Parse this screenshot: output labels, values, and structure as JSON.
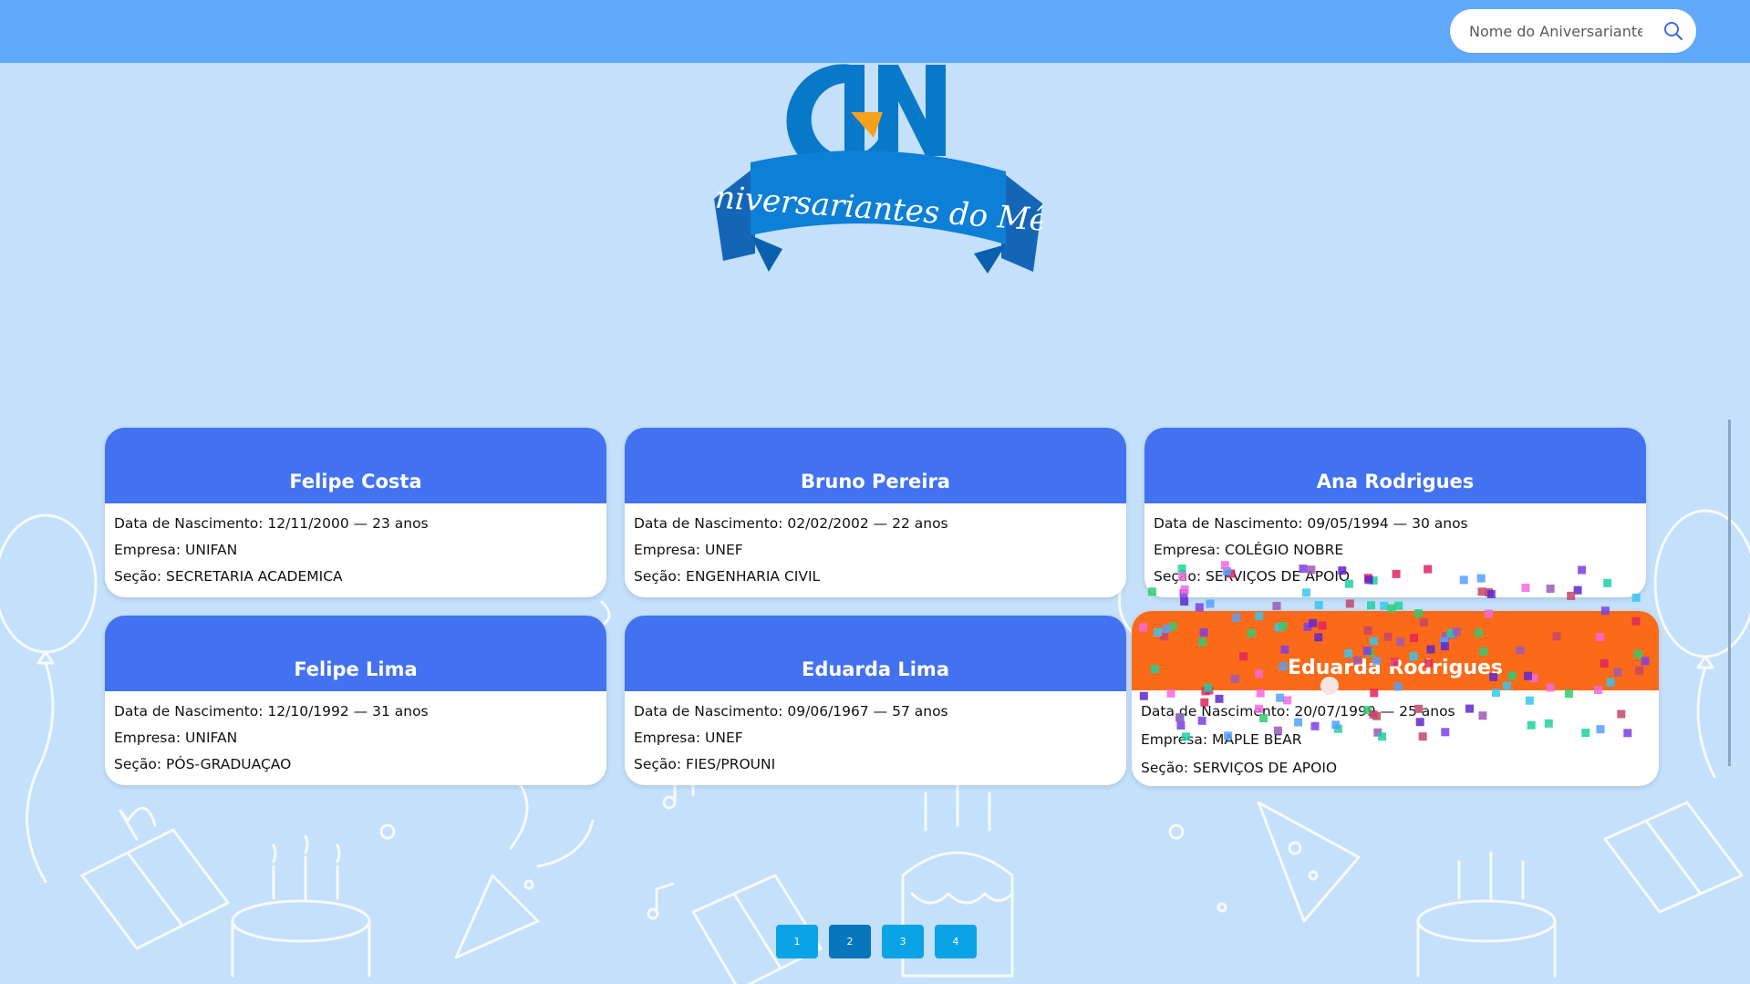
{
  "search": {
    "placeholder": "Nome do Aniversariante 🎂",
    "icon": "search-icon"
  },
  "logo": {
    "monogram": "CN",
    "banner_text": "Aniversariantes do Mês"
  },
  "cards": [
    {
      "name": "Felipe Costa",
      "birth": "Data de Nascimento: 12/11/2000 — 23 anos",
      "company": "Empresa: UNIFAN",
      "section": "Seção: SECRETARIA ACADEMICA"
    },
    {
      "name": "Bruno Pereira",
      "birth": "Data de Nascimento: 02/02/2002 — 22 anos",
      "company": "Empresa: UNEF",
      "section": "Seção: ENGENHARIA CIVIL"
    },
    {
      "name": "Ana Rodrigues",
      "birth": "Data de Nascimento: 09/05/1994 — 30 anos",
      "company": "Empresa: COLÉGIO NOBRE",
      "section": "Seção: SERVIÇOS DE APOIO"
    },
    {
      "name": "Felipe Lima",
      "birth": "Data de Nascimento: 12/10/1992 — 31 anos",
      "company": "Empresa: UNIFAN",
      "section": "Seção: PÓS-GRADUAÇAO"
    },
    {
      "name": "Eduarda Lima",
      "birth": "Data de Nascimento: 09/06/1967 — 57 anos",
      "company": "Empresa: UNEF",
      "section": "Seção: FIES/PROUNI"
    },
    {
      "name": "Eduarda Rodrigues",
      "birth": "Data de Nascimento: 20/07/1999 — 25 anos",
      "company": "Empresa: MAPLE BEAR",
      "section": "Seção: SERVIÇOS DE APOIO"
    }
  ],
  "pagination": {
    "pages": [
      "1",
      "2",
      "3",
      "4"
    ],
    "active": "2"
  },
  "colors": {
    "topbar": "#61aafb",
    "background": "#c4e0fb",
    "card_header": "#4272f0",
    "card_header_highlight": "#fb6a18",
    "page_button": "#0aa3e6",
    "page_button_active": "#0776bc",
    "logo_blue": "#0878c8",
    "logo_accent": "#f7a01b"
  }
}
